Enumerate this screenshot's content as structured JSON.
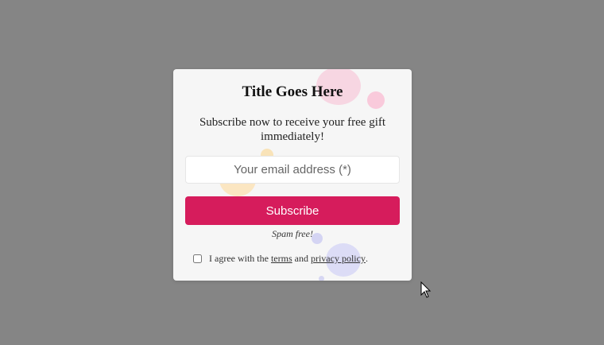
{
  "popup": {
    "title": "Title Goes Here",
    "subtitle": "Subscribe now to receive your free gift immediately!",
    "email_placeholder": "Your email address (*)",
    "subscribe_label": "Subscribe",
    "spam_note": "Spam free!",
    "agreement": {
      "prefix": "I agree with the ",
      "terms_label": "terms",
      "middle": " and ",
      "privacy_label": "privacy policy",
      "suffix": "."
    }
  },
  "colors": {
    "overlay": "#858585",
    "popup_background": "#f6f6f6",
    "accent": "#d61c5c"
  },
  "icons": {
    "cursor": "mouse-pointer-icon"
  }
}
